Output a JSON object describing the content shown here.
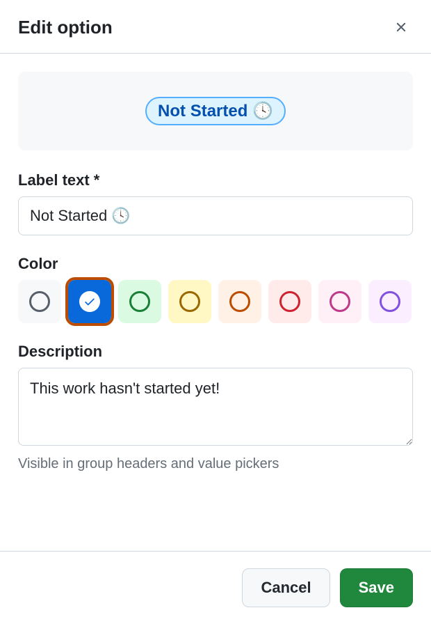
{
  "header": {
    "title": "Edit option"
  },
  "preview": {
    "label": "Not Started 🕓"
  },
  "fields": {
    "labelText": {
      "label": "Label text *",
      "value": "Not Started 🕓"
    },
    "color": {
      "label": "Color",
      "options": [
        {
          "id": "gray",
          "name": "Gray"
        },
        {
          "id": "blue",
          "name": "Blue",
          "selected": true
        },
        {
          "id": "green",
          "name": "Green"
        },
        {
          "id": "yellow",
          "name": "Yellow"
        },
        {
          "id": "orange",
          "name": "Orange"
        },
        {
          "id": "red",
          "name": "Red"
        },
        {
          "id": "pink",
          "name": "Pink"
        },
        {
          "id": "purple",
          "name": "Purple"
        }
      ]
    },
    "description": {
      "label": "Description",
      "value": "This work hasn't started yet!",
      "help": "Visible in group headers and value pickers"
    }
  },
  "footer": {
    "cancel": "Cancel",
    "save": "Save"
  }
}
